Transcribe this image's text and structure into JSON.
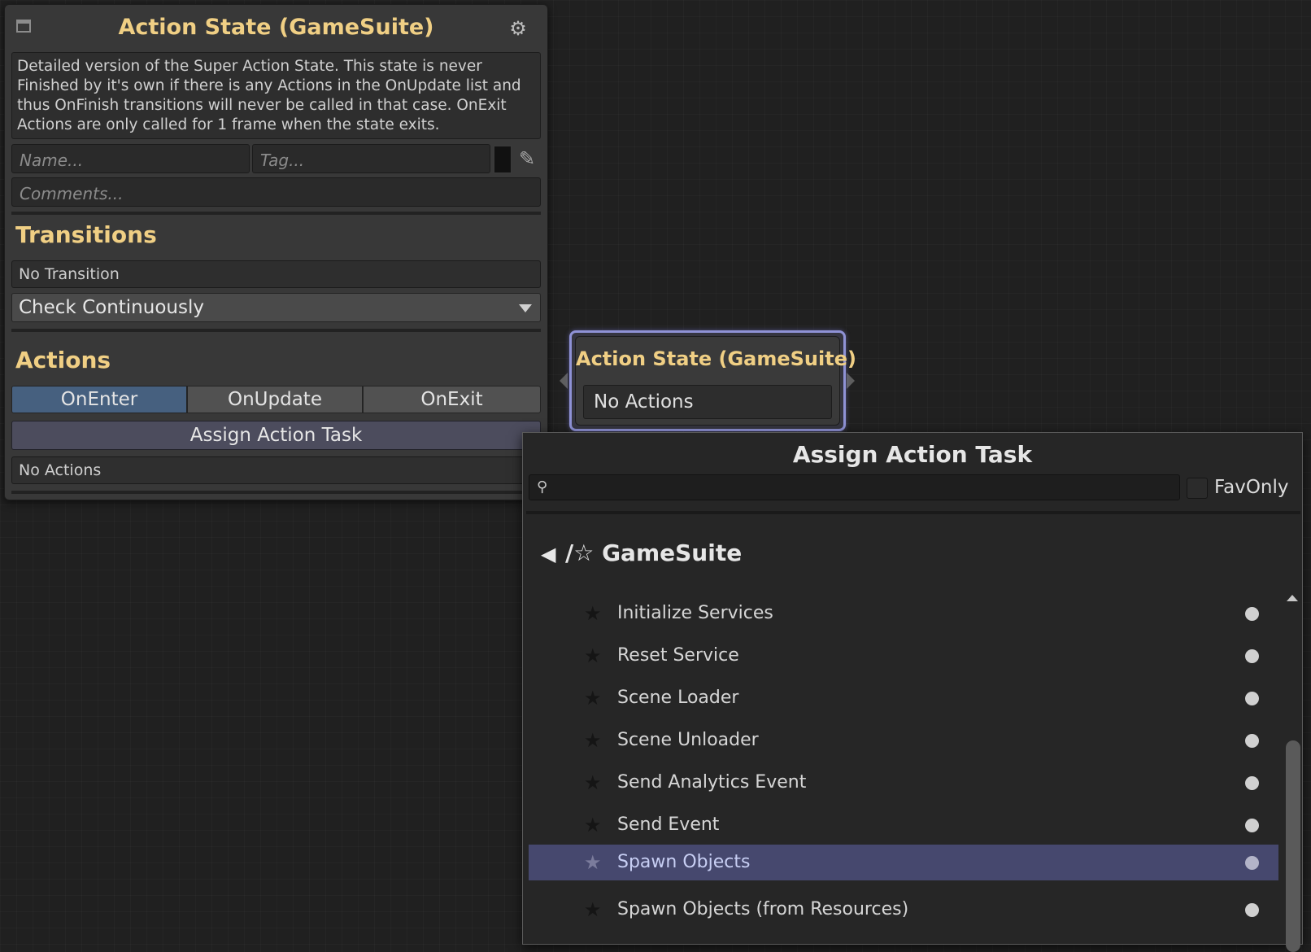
{
  "inspector": {
    "title": "Action State (GameSuite)",
    "minimize_icon": "window-minimize-icon",
    "settings_icon": "gear-icon",
    "description": "Detailed version of the Super Action State. This state is never Finished by it's own if there is any Actions in the OnUpdate list and thus OnFinish transitions will never be called in that case. OnExit Actions are only called for 1 frame when the state exits.",
    "name_placeholder": "Name...",
    "tag_placeholder": "Tag...",
    "comments_placeholder": "Comments...",
    "color_value": "#111111",
    "eyedropper_icon": "eyedropper-icon",
    "transitions": {
      "heading": "Transitions",
      "empty_text": "No Transition",
      "mode_selected": "Check Continuously"
    },
    "actions": {
      "heading": "Actions",
      "tabs": [
        {
          "label": "OnEnter",
          "active": true
        },
        {
          "label": "OnUpdate",
          "active": false
        },
        {
          "label": "OnExit",
          "active": false
        }
      ],
      "assign_button": "Assign Action Task",
      "empty_text": "No Actions"
    }
  },
  "node": {
    "title": "Action State (GameSuite)",
    "body": "No Actions",
    "selected": true
  },
  "popup": {
    "title": "Assign Action Task",
    "search_value": "",
    "search_icon": "search-icon",
    "favonly_label": "FavOnly",
    "favonly_checked": false,
    "back_icon": "back-arrow-icon",
    "category_path": "/☆ GameSuite",
    "items": [
      {
        "label": "Initialize Services",
        "selected": false
      },
      {
        "label": "Reset Service",
        "selected": false
      },
      {
        "label": "Scene Loader",
        "selected": false
      },
      {
        "label": "Scene Unloader",
        "selected": false
      },
      {
        "label": "Send Analytics Event",
        "selected": false
      },
      {
        "label": "Send Event",
        "selected": false
      },
      {
        "label": "Spawn Objects",
        "selected": true
      },
      {
        "label": "Spawn Objects (from Resources)",
        "selected": false
      }
    ]
  },
  "colors": {
    "accent_title": "#f0cf84",
    "active_tab": "#46607f",
    "selected_row": "#46486e",
    "node_outline": "#8f92d6",
    "background": "#202020"
  }
}
